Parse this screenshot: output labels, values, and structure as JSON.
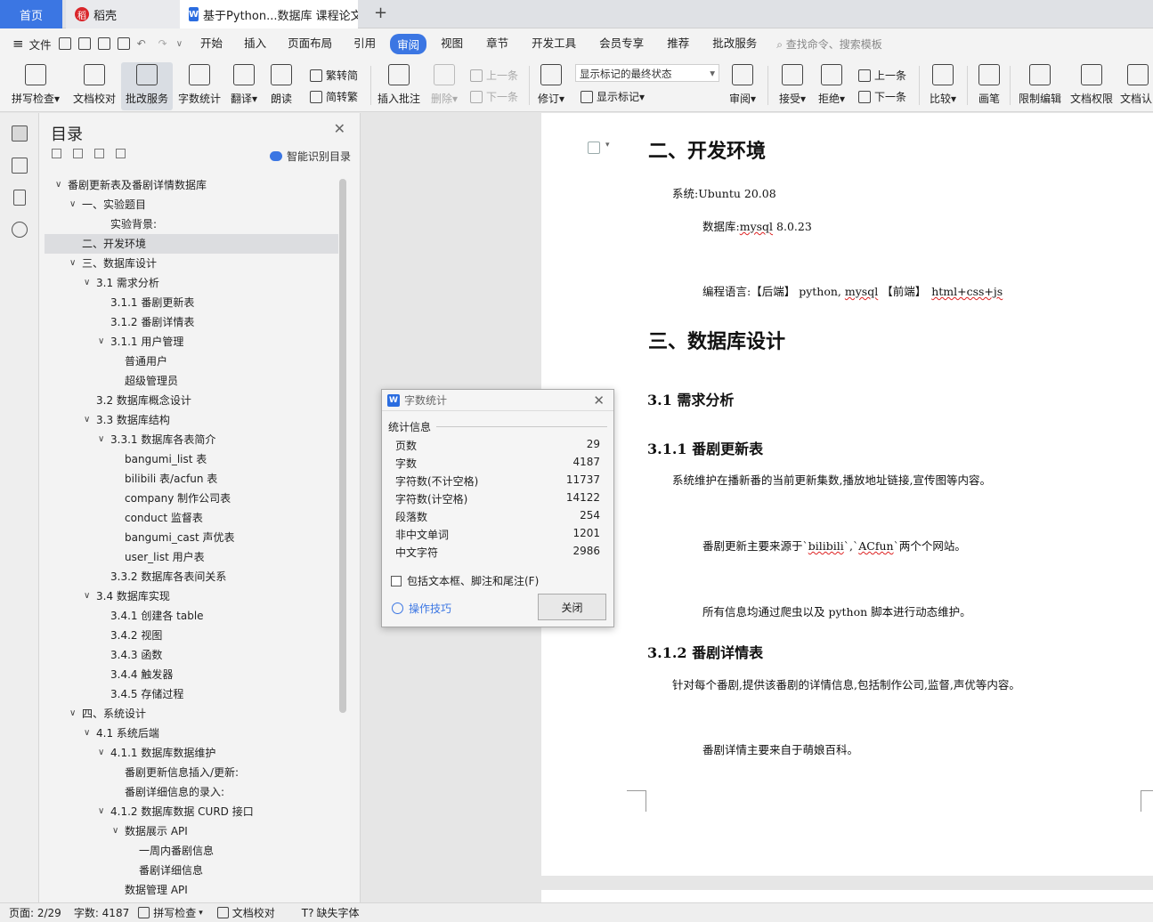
{
  "tabs": {
    "home": "首页",
    "daoke": "稻壳",
    "doc": "基于Python...数据库 课程论文"
  },
  "menubar": {
    "file": "文件",
    "items": [
      "开始",
      "插入",
      "页面布局",
      "引用",
      "审阅",
      "视图",
      "章节",
      "开发工具",
      "会员专享",
      "推荐",
      "批改服务"
    ],
    "active": "审阅",
    "search": "查找命令、搜索模板"
  },
  "ribbon": {
    "spell": "拼写检查",
    "proof": "文档校对",
    "correct": "批改服务",
    "wordcount": "字数统计",
    "translate": "翻译",
    "read": "朗读",
    "s2t": "繁转简",
    "t2s": "简转繁",
    "insert_comment": "插入批注",
    "delete": "删除",
    "prev": "上一条",
    "next": "下一条",
    "revise": "修订",
    "markup_state": "显示标记的最终状态",
    "show_markup": "显示标记",
    "review": "审阅",
    "accept": "接受",
    "reject": "拒绝",
    "prev2": "上一条",
    "next2": "下一条",
    "compare": "比较",
    "pen": "画笔",
    "restrict": "限制编辑",
    "rights": "文档权限",
    "auth": "文档认"
  },
  "toc": {
    "title": "目录",
    "smart": "智能识别目录",
    "items": [
      {
        "label": "番剧更新表及番剧详情数据库",
        "level": 0,
        "chev": true
      },
      {
        "label": "一、实验题目",
        "level": 1,
        "chev": true
      },
      {
        "label": "实验背景:",
        "level": 3,
        "chev": false
      },
      {
        "label": "二、开发环境",
        "level": 1,
        "chev": false,
        "selected": true
      },
      {
        "label": "三、数据库设计",
        "level": 1,
        "chev": true
      },
      {
        "label": "3.1 需求分析",
        "level": 2,
        "chev": true
      },
      {
        "label": "3.1.1 番剧更新表",
        "level": 3,
        "chev": false
      },
      {
        "label": "3.1.2 番剧详情表",
        "level": 3,
        "chev": false
      },
      {
        "label": "3.1.1 用户管理",
        "level": 3,
        "chev": true
      },
      {
        "label": "普通用户",
        "level": 4,
        "chev": false
      },
      {
        "label": "超级管理员",
        "level": 4,
        "chev": false
      },
      {
        "label": "3.2 数据库概念设计",
        "level": 2,
        "chev": false
      },
      {
        "label": "3.3 数据库结构",
        "level": 2,
        "chev": true
      },
      {
        "label": "3.3.1 数据库各表简介",
        "level": 3,
        "chev": true
      },
      {
        "label": "bangumi_list 表",
        "level": 4,
        "chev": false
      },
      {
        "label": "bilibili 表/acfun 表",
        "level": 4,
        "chev": false
      },
      {
        "label": "company 制作公司表",
        "level": 4,
        "chev": false
      },
      {
        "label": "conduct 监督表",
        "level": 4,
        "chev": false
      },
      {
        "label": "bangumi_cast 声优表",
        "level": 4,
        "chev": false
      },
      {
        "label": "user_list 用户表",
        "level": 4,
        "chev": false
      },
      {
        "label": "3.3.2 数据库各表间关系",
        "level": 3,
        "chev": false
      },
      {
        "label": "3.4 数据库实现",
        "level": 2,
        "chev": true
      },
      {
        "label": "3.4.1 创建各 table",
        "level": 3,
        "chev": false
      },
      {
        "label": "3.4.2 视图",
        "level": 3,
        "chev": false
      },
      {
        "label": "3.4.3 函数",
        "level": 3,
        "chev": false
      },
      {
        "label": "3.4.4 触发器",
        "level": 3,
        "chev": false
      },
      {
        "label": "3.4.5 存储过程",
        "level": 3,
        "chev": false
      },
      {
        "label": "四、系统设计",
        "level": 1,
        "chev": true
      },
      {
        "label": "4.1 系统后端",
        "level": 2,
        "chev": true
      },
      {
        "label": "4.1.1 数据库数据维护",
        "level": 3,
        "chev": true
      },
      {
        "label": "番剧更新信息插入/更新:",
        "level": 4,
        "chev": false
      },
      {
        "label": "番剧详细信息的录入:",
        "level": 4,
        "chev": false
      },
      {
        "label": "4.1.2 数据库数据 CURD 接口",
        "level": 3,
        "chev": true
      },
      {
        "label": "数据展示 API",
        "level": 4,
        "chev": true
      },
      {
        "label": "一周内番剧信息",
        "level": 5,
        "chev": false
      },
      {
        "label": "番剧详细信息",
        "level": 5,
        "chev": false
      },
      {
        "label": "数据管理 API",
        "level": 4,
        "chev": false
      }
    ]
  },
  "document": {
    "h_env": "二、开发环境",
    "sys_label": "系统:",
    "sys_val": "Ubuntu 20.08",
    "db_label": "数据库:",
    "db_val1": "mysql",
    "db_val2": " 8.0.23",
    "lang_label": "编程语言:",
    "lang_b1": "【后端】",
    "lang_py": " python, ",
    "lang_mysql": "mysql",
    "lang_b2": " 【前端】",
    "lang_fe": "html+css+js",
    "h_db": "三、数据库设计",
    "h_31": "3.1 需求分析",
    "h_311": "3.1.1 番剧更新表",
    "p1": "系统维护在播新番的当前更新集数,播放地址链接,宣传图等内容。",
    "p2_a": "番剧更新主要来源于`",
    "p2_bili": "bilibili",
    "p2_b": "`,`",
    "p2_ac": "ACfun",
    "p2_c": "`两个个网站。",
    "p3": "所有信息均通过爬虫以及 python 脚本进行动态维护。",
    "h_312": "3.1.2 番剧详情表",
    "p4": "针对每个番剧,提供该番剧的详情信息,包括制作公司,监督,声优等内容。",
    "p5": "番剧详情主要来自于萌娘百科。"
  },
  "dialog": {
    "title": "字数统计",
    "section": "统计信息",
    "stats": [
      {
        "label": "页数",
        "value": "29"
      },
      {
        "label": "字数",
        "value": "4187"
      },
      {
        "label": "字符数(不计空格)",
        "value": "11737"
      },
      {
        "label": "字符数(计空格)",
        "value": "14122"
      },
      {
        "label": "段落数",
        "value": "254"
      },
      {
        "label": "非中文单词",
        "value": "1201"
      },
      {
        "label": "中文字符",
        "value": "2986"
      }
    ],
    "include": "包括文本框、脚注和尾注(F)",
    "tips": "操作技巧",
    "close": "关闭"
  },
  "status": {
    "page": "页面: 2/29",
    "words": "字数: 4187",
    "spell": "拼写检查",
    "proof": "文档校对",
    "missing_font": "缺失字体"
  },
  "colors": {
    "accent": "#3b76e3",
    "daoke": "#d9262b"
  }
}
